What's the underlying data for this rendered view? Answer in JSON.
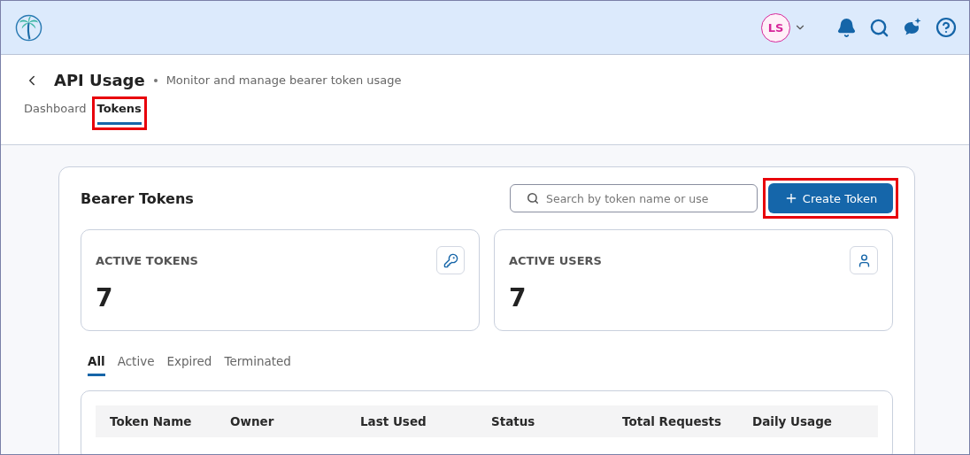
{
  "header": {
    "avatar_initials": "LS"
  },
  "page": {
    "title": "API Usage",
    "subtitle": "Monitor and manage bearer token usage",
    "tabs": [
      {
        "label": "Dashboard",
        "selected": false,
        "highlighted": false
      },
      {
        "label": "Tokens",
        "selected": true,
        "highlighted": true
      }
    ]
  },
  "panel": {
    "title": "Bearer Tokens",
    "search": {
      "placeholder": "Search by token name or use"
    },
    "create_button": {
      "label": "Create Token",
      "highlighted": true
    },
    "stats": [
      {
        "label": "ACTIVE TOKENS",
        "value": "7",
        "kind": "key"
      },
      {
        "label": "ACTIVE USERS",
        "value": "7",
        "kind": "user"
      }
    ],
    "filters": [
      {
        "label": "All",
        "selected": true
      },
      {
        "label": "Active",
        "selected": false
      },
      {
        "label": "Expired",
        "selected": false
      },
      {
        "label": "Terminated",
        "selected": false
      }
    ],
    "table": {
      "columns": [
        "Token Name",
        "Owner",
        "Last Used",
        "Status",
        "Total Requests",
        "Daily Usage"
      ]
    }
  }
}
